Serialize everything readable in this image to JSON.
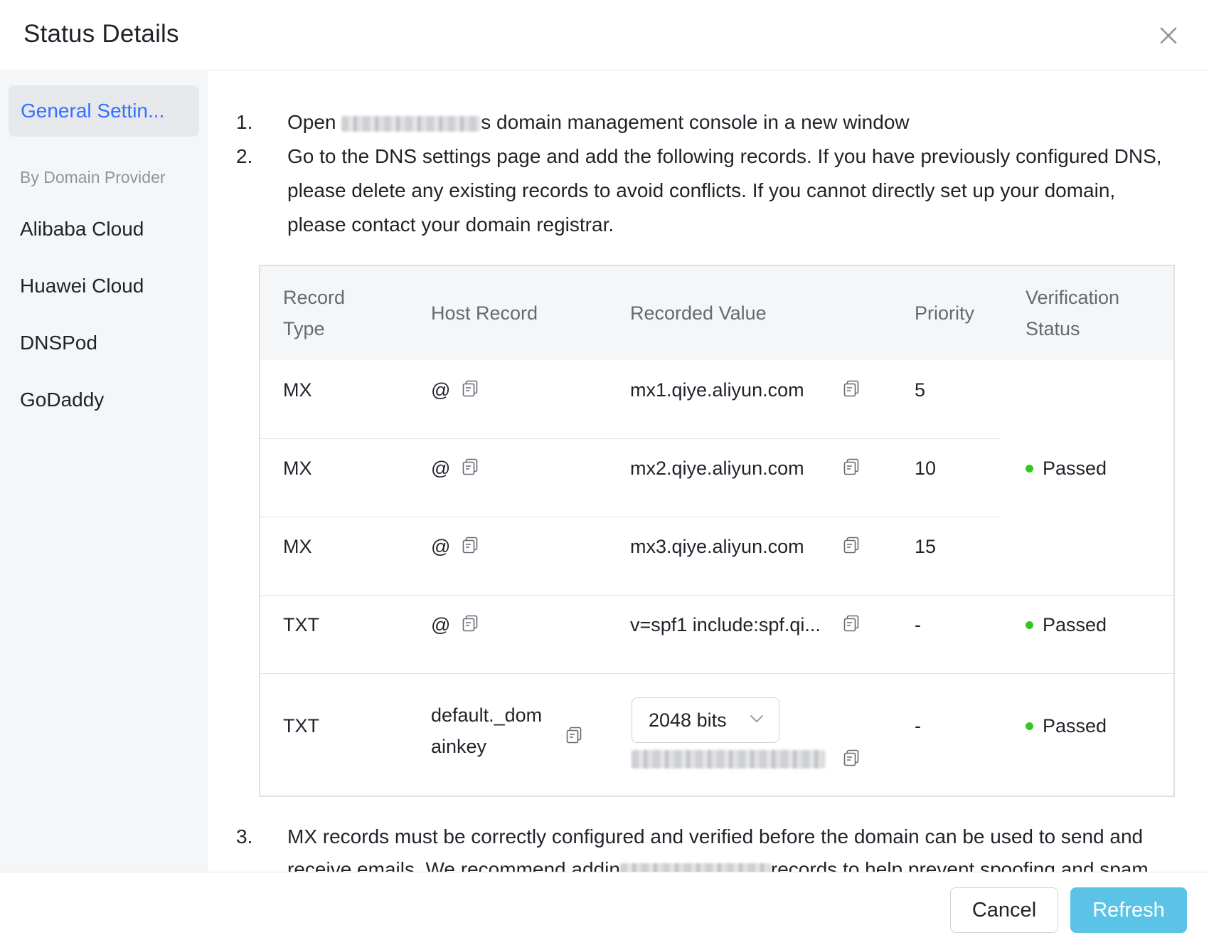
{
  "dialog": {
    "title": "Status Details"
  },
  "sidebar": {
    "active_item": "General Settin...",
    "group_label": "By Domain Provider",
    "items": [
      "Alibaba Cloud",
      "Huawei Cloud",
      "DNSPod",
      "GoDaddy"
    ]
  },
  "steps": {
    "s1_num": "1.",
    "s1_before": "Open ",
    "s1_after": "s domain management console in a new window",
    "s2_num": "2.",
    "s2_lines": [
      "Go to the DNS settings page and add the following records. If you have previously configured DNS,",
      "please delete any existing records to avoid conflicts. If you cannot directly set up your domain,",
      "please contact your domain registrar."
    ],
    "s3_num": "3.",
    "s3_line1": "MX records must be correctly configured and verified before the domain can be used to send and",
    "s3_line2_before": "receive emails. We recommend addin",
    "s3_line2_after": "records to help prevent spoofing and spam."
  },
  "table": {
    "headers": {
      "record_type": [
        "Record",
        "Type"
      ],
      "host_record": "Host Record",
      "recorded_value": "Recorded Value",
      "priority": "Priority",
      "verification_status": [
        "Verification",
        "Status"
      ]
    },
    "rows": [
      {
        "type": "MX",
        "host": "@",
        "value": "mx1.qiye.aliyun.com",
        "priority": "5"
      },
      {
        "type": "MX",
        "host": "@",
        "value": "mx2.qiye.aliyun.com",
        "priority": "10"
      },
      {
        "type": "MX",
        "host": "@",
        "value": "mx3.qiye.aliyun.com",
        "priority": "15"
      },
      {
        "type": "TXT",
        "host": "@",
        "value": "v=spf1 include:spf.qi...",
        "priority": "-"
      },
      {
        "type": "TXT",
        "host_lines": [
          "default._dom",
          "ainkey"
        ],
        "select": "2048 bits",
        "priority": "-"
      }
    ],
    "status_mx": "Passed",
    "status_spf": "Passed",
    "status_dkim": "Passed",
    "status_color": "#34c724"
  },
  "footer": {
    "cancel_label": "Cancel",
    "refresh_label": "Refresh"
  },
  "colors": {
    "accent": "#3370ff",
    "refresh_button": "#5bc4e6"
  },
  "icons": {
    "close": "close-icon",
    "copy": "copy-icon",
    "dropdown": "chevron-down-icon"
  }
}
